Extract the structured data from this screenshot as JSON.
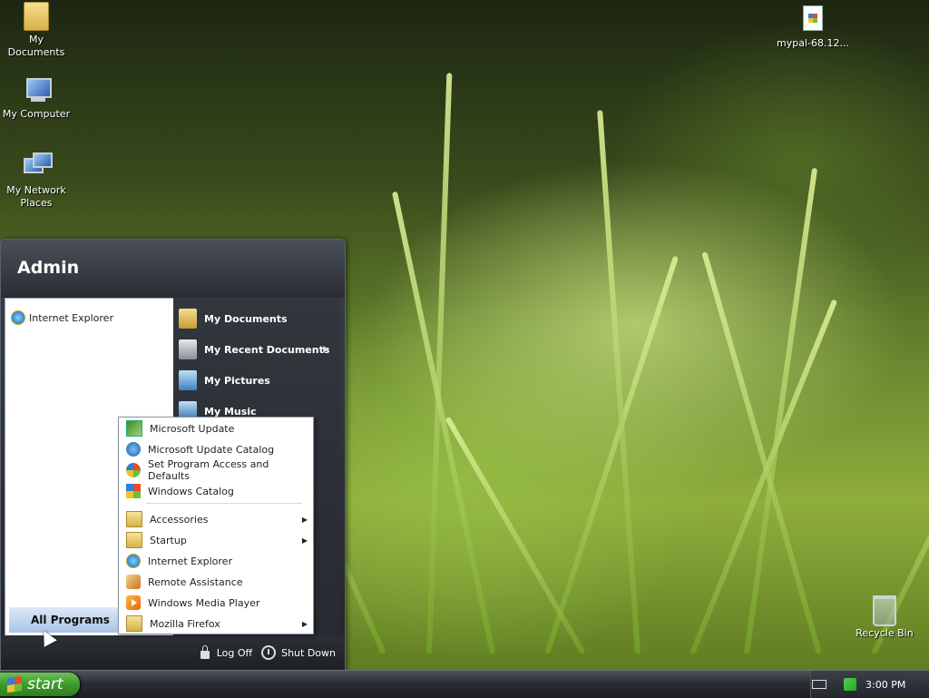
{
  "desktop": {
    "icons": [
      {
        "label": "My Documents",
        "icon": "folder-icon"
      },
      {
        "label": "My Computer",
        "icon": "computer-icon"
      },
      {
        "label": "My Network Places",
        "icon": "network-icon"
      },
      {
        "label": "mypal-68.12...",
        "icon": "document-icon"
      },
      {
        "label": "Recycle Bin",
        "icon": "recycle-bin-icon"
      }
    ]
  },
  "start_menu": {
    "user": "Admin",
    "pinned": [
      {
        "label": "Internet Explorer",
        "icon": "internet-explorer-icon"
      }
    ],
    "all_programs_label": "All Programs",
    "right_items": [
      {
        "label": "My Documents",
        "icon": "documents-icon"
      },
      {
        "label": "My Recent Documents",
        "icon": "recent-documents-icon",
        "has_submenu": true
      },
      {
        "label": "My Pictures",
        "icon": "pictures-icon"
      },
      {
        "label": "My Music",
        "icon": "music-icon"
      }
    ],
    "footer": {
      "log_off": "Log Off",
      "shut_down": "Shut Down"
    }
  },
  "all_programs_menu": {
    "items": [
      {
        "label": "Microsoft Update",
        "icon": "microsoft-update-icon"
      },
      {
        "label": "Microsoft Update Catalog",
        "icon": "catalog-icon"
      },
      {
        "label": "Set Program Access and Defaults",
        "icon": "program-access-icon"
      },
      {
        "label": "Windows Catalog",
        "icon": "windows-catalog-icon"
      },
      {
        "label": "Accessories",
        "icon": "folder-icon",
        "has_submenu": true
      },
      {
        "label": "Startup",
        "icon": "folder-icon",
        "has_submenu": true
      },
      {
        "label": "Internet Explorer",
        "icon": "internet-explorer-icon"
      },
      {
        "label": "Remote Assistance",
        "icon": "remote-assistance-icon"
      },
      {
        "label": "Windows Media Player",
        "icon": "media-player-icon"
      },
      {
        "label": "Mozilla Firefox",
        "icon": "folder-icon",
        "has_submenu": true
      }
    ]
  },
  "taskbar": {
    "start_label": "start",
    "clock": "3:00 PM"
  },
  "colors": {
    "taskbar": "#2a2e34",
    "start_button": "#3e9a2c",
    "menu_dark": "#2a2d33"
  }
}
